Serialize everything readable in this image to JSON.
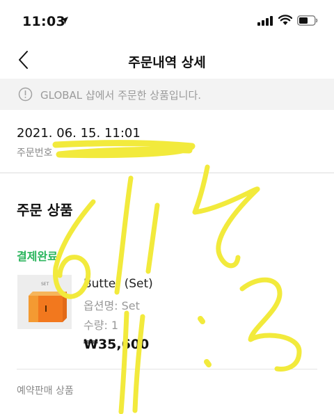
{
  "status_bar": {
    "time": "11:03"
  },
  "nav": {
    "title": "주문내역 상세"
  },
  "notice": {
    "text": "GLOBAL 샵에서 주문한 상품입니다."
  },
  "order": {
    "date": "2021. 06. 15. 11:01",
    "number_label": "주문번호"
  },
  "products": {
    "section_title": "주문 상품",
    "status": "결제완료",
    "item": {
      "thumb_label": "SET",
      "name": "Butter (Set)",
      "option": "옵션명: Set",
      "quantity": "수량: 1",
      "price": "₩35,600"
    },
    "preorder_label": "예약판매 상품"
  },
  "handwriting": {
    "color": "#f2ea3c"
  }
}
